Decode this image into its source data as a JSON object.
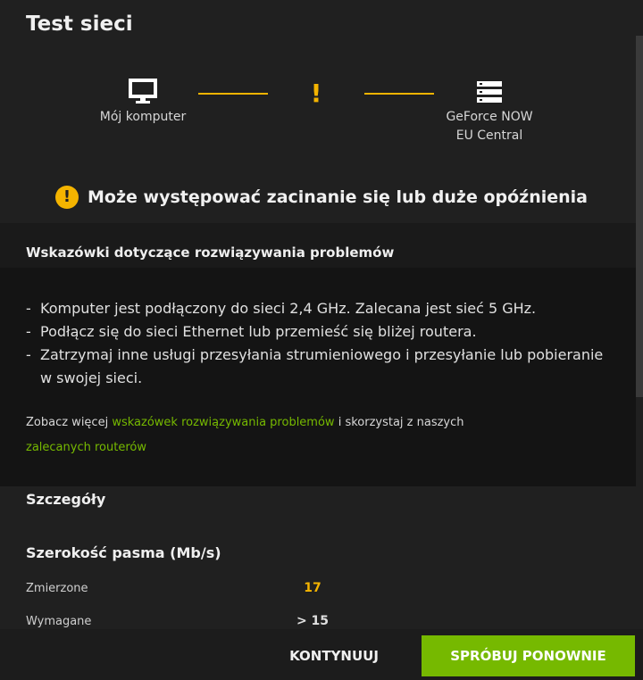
{
  "title": "Test sieci",
  "diagram": {
    "local": {
      "label": "Mój komputer",
      "icon": "monitor-icon"
    },
    "link_status_icon": "exclamation-icon",
    "link_status_glyph": "!",
    "remote": {
      "label_line1": "GeForce NOW",
      "label_line2": "EU Central",
      "icon": "server-icon"
    }
  },
  "status": {
    "icon": "warning-circle-icon",
    "glyph": "!",
    "text": "Może występować zacinanie się lub duże opóźnienia"
  },
  "tips": {
    "header": "Wskazówki dotyczące rozwiązywania problemów",
    "items": [
      "Komputer jest podłączony do sieci 2,4 GHz. Zalecana jest sieć 5 GHz.",
      "Podłącz się do sieci Ethernet lub przemieść się bliżej routera.",
      "Zatrzymaj inne usługi przesyłania strumieniowego i przesyłanie lub pobieranie w swojej sieci."
    ],
    "more_prefix": "Zobacz więcej ",
    "more_link1": "wskazówek rozwiązywania problemów",
    "more_middle": " i skorzystaj z naszych ",
    "more_link2": "zalecanych routerów"
  },
  "details": {
    "title": "Szczegóły",
    "bandwidth_title": "Szerokość pasma (Mb/s)",
    "measured_label": "Zmierzone",
    "measured_value": "17",
    "required_label": "Wymagane",
    "required_value": "> 15"
  },
  "footer": {
    "continue_label": "KONTYNUUJ",
    "retry_label": "SPRÓBUJ PONOWNIE"
  },
  "colors": {
    "accent_green": "#76b900",
    "warning": "#f4b400",
    "background": "#202020"
  }
}
